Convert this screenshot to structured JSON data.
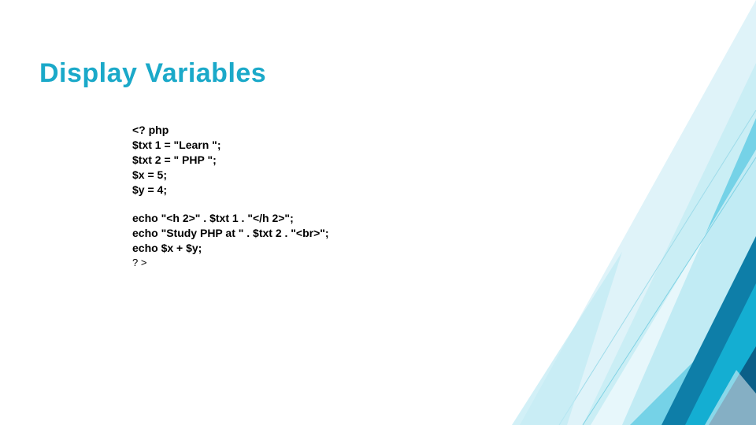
{
  "title": "Display Variables",
  "code": {
    "l1": "<? php",
    "l2": "$txt 1 = \"Learn \";",
    "l3": "$txt 2 = \" PHP \";",
    "l4": "$x = 5;",
    "l5": "$y = 4;",
    "l6": "echo \"<h 2>\" . $txt 1 . \"</h 2>\";",
    "l7": "echo \"Study PHP at \" . $txt 2 . \"<br>\";",
    "l8": "echo $x + $y;",
    "l9": "? >"
  }
}
